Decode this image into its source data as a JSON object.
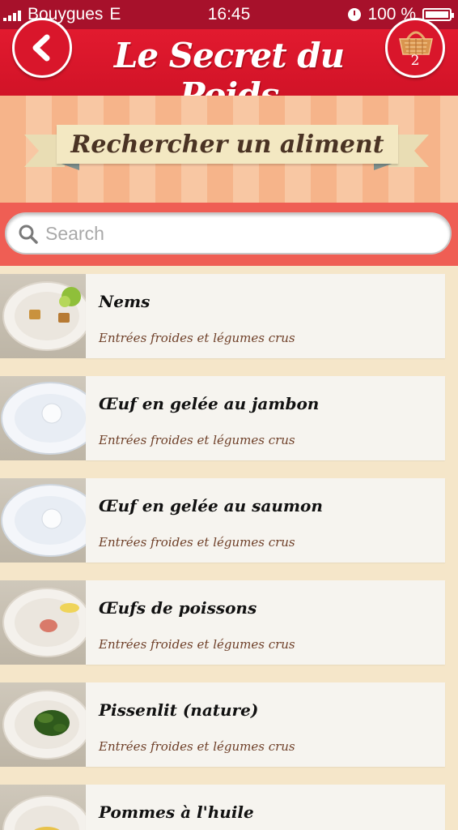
{
  "status_bar": {
    "carrier": "Bouygues",
    "network": "E",
    "time": "16:45",
    "battery": "100 %"
  },
  "header": {
    "title": "Le Secret du Poids",
    "back_icon": "chevron-left-icon",
    "basket_icon": "basket-icon",
    "basket_count": "2"
  },
  "banner": {
    "title": "Rechercher un aliment"
  },
  "search": {
    "placeholder": "Search",
    "value": ""
  },
  "foods": [
    {
      "name": "Nems",
      "category": "Entrées froides et légumes crus"
    },
    {
      "name": "Œuf en gelée au jambon",
      "category": "Entrées froides et légumes crus"
    },
    {
      "name": "Œuf en gelée au saumon",
      "category": "Entrées froides et légumes crus"
    },
    {
      "name": "Œufs de poissons",
      "category": "Entrées froides et légumes crus"
    },
    {
      "name": "Pissenlit (nature)",
      "category": "Entrées froides et légumes crus"
    },
    {
      "name": "Pommes à l'huile",
      "category": ""
    }
  ],
  "colors": {
    "header_red": "#e21a2f",
    "status_bar": "#a7112b",
    "search_band": "#ef5e54",
    "list_background": "#f5e6c9",
    "category_text": "#6e3f28"
  }
}
